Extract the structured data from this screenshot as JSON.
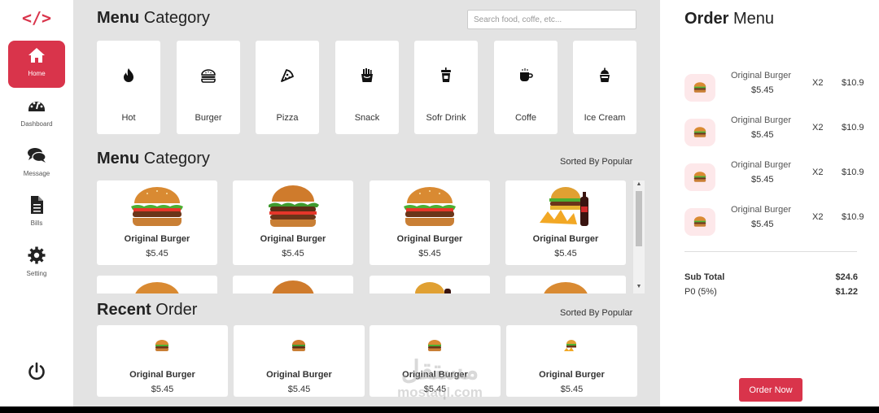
{
  "sidebar": {
    "logo": "</>",
    "items": [
      {
        "label": "Home",
        "icon": "home-icon",
        "active": true
      },
      {
        "label": "Dashboard",
        "icon": "dashboard-icon"
      },
      {
        "label": "Message",
        "icon": "message-icon"
      },
      {
        "label": "Bills",
        "icon": "bills-icon"
      },
      {
        "label": "Setting",
        "icon": "gear-icon"
      }
    ],
    "power_icon": "power-icon"
  },
  "main": {
    "category_heading": {
      "bold": "Menu",
      "rest": " Category"
    },
    "search": {
      "placeholder": "Search food, coffe, etc..."
    },
    "categories": [
      {
        "label": "Hot",
        "icon": "fire-icon"
      },
      {
        "label": "Burger",
        "icon": "burger-icon"
      },
      {
        "label": "Pizza",
        "icon": "pizza-icon"
      },
      {
        "label": "Snack",
        "icon": "fries-icon"
      },
      {
        "label": "Sofr Drink",
        "icon": "soft-drink-icon"
      },
      {
        "label": "Coffe",
        "icon": "coffee-icon"
      },
      {
        "label": "Ice Cream",
        "icon": "ice-cream-icon"
      }
    ],
    "menu_heading": {
      "bold": "Menu",
      "rest": " Category"
    },
    "menu_sort": "Sorted By Popular",
    "menu_items": [
      {
        "name": "Original Burger",
        "price": "$5.45",
        "image": "burger"
      },
      {
        "name": "Original Burger",
        "price": "$5.45",
        "image": "burger"
      },
      {
        "name": "Original Burger",
        "price": "$5.45",
        "image": "burger"
      },
      {
        "name": "Original Burger",
        "price": "$5.45",
        "image": "burger-combo"
      },
      {
        "name": "",
        "price": "",
        "image": "burger"
      },
      {
        "name": "",
        "price": "",
        "image": "burger"
      },
      {
        "name": "",
        "price": "",
        "image": "burger-combo"
      },
      {
        "name": "",
        "price": "",
        "image": "burger"
      }
    ],
    "recent_heading": {
      "bold": "Recent",
      "rest": " Order"
    },
    "recent_sort": "Sorted By Popular",
    "recent_items": [
      {
        "name": "Original Burger",
        "price": "$5.45",
        "image": "burger"
      },
      {
        "name": "Original Burger",
        "price": "$5.45",
        "image": "burger"
      },
      {
        "name": "Original Burger",
        "price": "$5.45",
        "image": "burger"
      },
      {
        "name": "Original Burger",
        "price": "$5.45",
        "image": "burger-combo"
      }
    ],
    "watermark": {
      "arabic": "مستقل",
      "latin": "mostaql.com"
    }
  },
  "order": {
    "title": {
      "bold": "Order",
      "rest": " Menu"
    },
    "lines": [
      {
        "name": "Original Burger",
        "price": "$5.45",
        "qty": "X2",
        "total": "$10.9"
      },
      {
        "name": "Original Burger",
        "price": "$5.45",
        "qty": "X2",
        "total": "$10.9"
      },
      {
        "name": "Original Burger",
        "price": "$5.45",
        "qty": "X2",
        "total": "$10.9"
      },
      {
        "name": "Original Burger",
        "price": "$5.45",
        "qty": "X2",
        "total": "$10.9"
      }
    ],
    "subtotal": {
      "label": "Sub Total",
      "value": "$24.6"
    },
    "tax": {
      "label": "P0 (5%)",
      "value": "$1.22"
    },
    "button": "Order Now"
  },
  "colors": {
    "accent": "#d9344b",
    "main_bg": "#e3e3e3",
    "thumb_bg": "#fde8ea"
  }
}
